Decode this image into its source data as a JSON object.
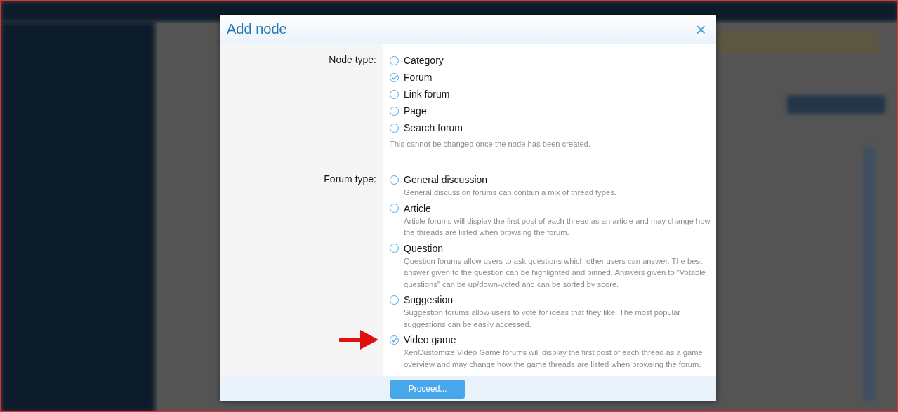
{
  "dialog": {
    "title": "Add node",
    "close": "×",
    "button": "Proceed..."
  },
  "groups": [
    {
      "label": "Node type:",
      "options": [
        {
          "label": "Category",
          "selected": false
        },
        {
          "label": "Forum",
          "selected": true
        },
        {
          "label": "Link forum",
          "selected": false
        },
        {
          "label": "Page",
          "selected": false
        },
        {
          "label": "Search forum",
          "selected": false
        }
      ],
      "explain": "This cannot be changed once the node has been created."
    },
    {
      "label": "Forum type:",
      "options": [
        {
          "label": "General discussion",
          "selected": false,
          "description": "General discussion forums can contain a mix of thread types."
        },
        {
          "label": "Article",
          "selected": false,
          "description": "Article forums will display the first post of each thread as an article and may change how the threads are listed when browsing the forum."
        },
        {
          "label": "Question",
          "selected": false,
          "description": "Question forums allow users to ask questions which other users can answer. The best answer given to the question can be highlighted and pinned. Answers given to \"Votable questions\" can be up/down-voted and can be sorted by score."
        },
        {
          "label": "Suggestion",
          "selected": false,
          "description": "Suggestion forums allow users to vote for ideas that they like. The most popular suggestions can be easily accessed."
        },
        {
          "label": "Video game",
          "selected": true,
          "description": "XenCustomize Video Game forums will display the first post of each thread as a game overview and may change how the game threads are listed when browsing the forum.",
          "pointer": true
        }
      ]
    }
  ]
}
